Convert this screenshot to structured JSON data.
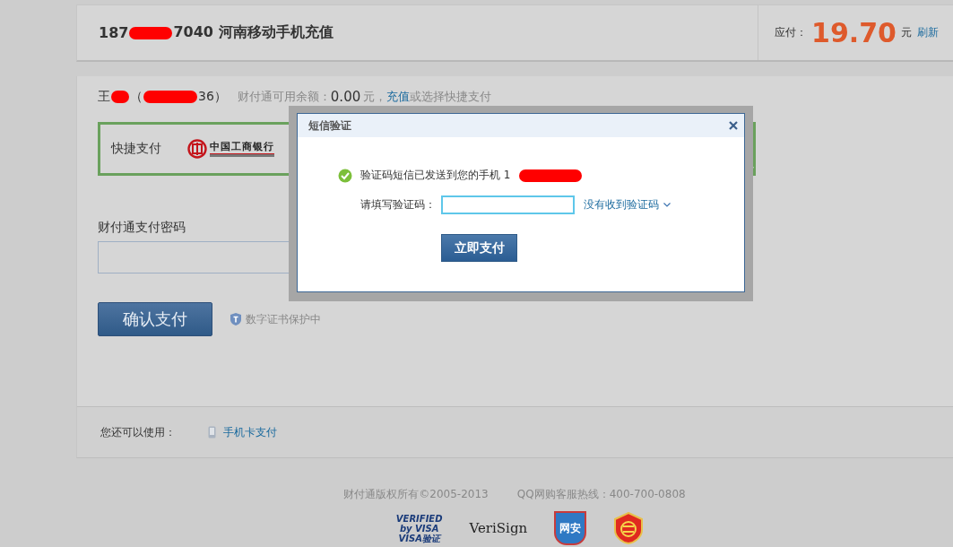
{
  "order": {
    "phone_start": "187",
    "phone_end": "7040",
    "title": "河南移动手机充值",
    "amount_label": "应付：",
    "amount": "19.70",
    "currency": "元",
    "refresh": "刷新"
  },
  "account": {
    "name": "王",
    "open_paren": "（",
    "id_end": "36）",
    "balance_label": "财付通可用余额：",
    "balance": "0.00",
    "balance_unit": "元，",
    "recharge": "充值",
    "hint": "或选择快捷支付"
  },
  "quick_pay": {
    "label": "快捷支付",
    "bank": "中国工商银行",
    "selected": true
  },
  "password": {
    "label": "财付通支付密码"
  },
  "confirm_button": "确认支付",
  "cert_note": "数字证书保护中",
  "alternatives": {
    "label": "您还可以使用：",
    "items": [
      {
        "label": "手机卡支付"
      }
    ]
  },
  "footer": {
    "copyright": "财付通版权所有©2005-2013",
    "hotline": "QQ网购客服热线：400-700-0808",
    "badges": [
      {
        "kind": "visa",
        "lines": [
          "VERIFIED",
          "by VISA",
          "VISA验证"
        ]
      },
      {
        "kind": "verisign",
        "text": "VeriSign"
      },
      {
        "kind": "shield",
        "text": "网安"
      },
      {
        "kind": "seal"
      }
    ]
  },
  "dialog": {
    "title": "短信验证",
    "message_start": "验证码短信已发送到您的手机 1",
    "code_label": "请填写验证码：",
    "resend": "没有收到验证码",
    "submit": "立即支付"
  }
}
